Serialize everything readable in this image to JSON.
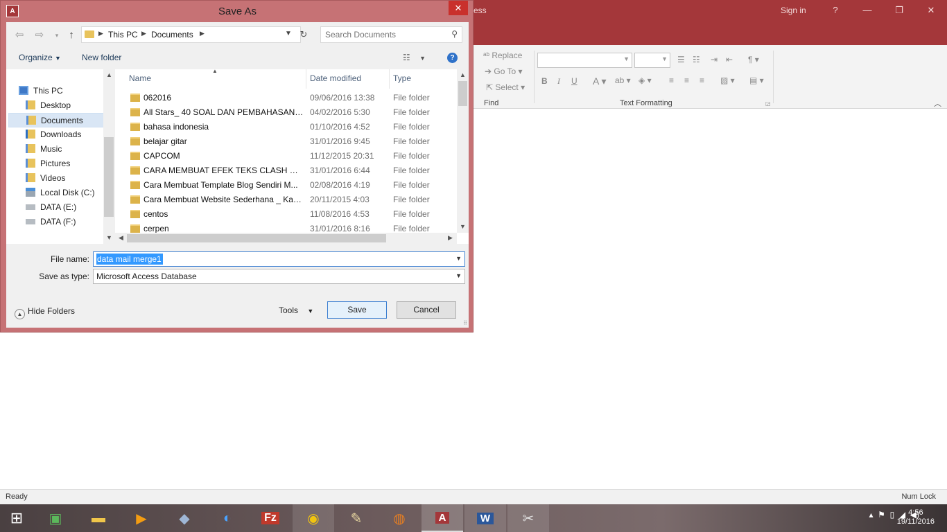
{
  "access": {
    "title_fragment": "ess",
    "sign_in": "Sign in",
    "help": "?",
    "ribbon": {
      "replace": "Replace",
      "go_to": "Go To",
      "select": "Select",
      "find_group": "Find",
      "text_formatting_group": "Text Formatting",
      "bold": "B",
      "italic": "I",
      "underline": "U"
    },
    "status": {
      "left": "Ready",
      "right": "Num Lock"
    }
  },
  "dialog": {
    "title": "Save As",
    "app_icon_text": "A",
    "close": "✕",
    "breadcrumbs": [
      "This PC",
      "Documents"
    ],
    "search_placeholder": "Search Documents",
    "organize": "Organize",
    "new_folder": "New folder",
    "help": "?",
    "nav": [
      {
        "label": "This PC",
        "icon": "computer-icon",
        "indent": 0
      },
      {
        "label": "Desktop",
        "icon": "desktop-icon",
        "indent": 1
      },
      {
        "label": "Documents",
        "icon": "documents-icon",
        "indent": 1,
        "selected": true
      },
      {
        "label": "Downloads",
        "icon": "downloads-icon",
        "indent": 1
      },
      {
        "label": "Music",
        "icon": "music-icon",
        "indent": 1
      },
      {
        "label": "Pictures",
        "icon": "pictures-icon",
        "indent": 1
      },
      {
        "label": "Videos",
        "icon": "videos-icon",
        "indent": 1
      },
      {
        "label": "Local Disk (C:)",
        "icon": "disk-icon",
        "indent": 1
      },
      {
        "label": "DATA (E:)",
        "icon": "drive-icon",
        "indent": 1
      },
      {
        "label": "DATA (F:)",
        "icon": "drive-icon",
        "indent": 1
      }
    ],
    "columns": {
      "name": "Name",
      "date": "Date modified",
      "type": "Type"
    },
    "files": [
      {
        "name": "062016",
        "date": "09/06/2016 13:38",
        "type": "File folder"
      },
      {
        "name": "All Stars_ 40 SOAL DAN PEMBAHASAN D...",
        "date": "04/02/2016 5:30",
        "type": "File folder"
      },
      {
        "name": "bahasa indonesia",
        "date": "01/10/2016 4:52",
        "type": "File folder"
      },
      {
        "name": "belajar gitar",
        "date": "31/01/2016 9:45",
        "type": "File folder"
      },
      {
        "name": "CAPCOM",
        "date": "11/12/2015 20:31",
        "type": "File folder"
      },
      {
        "name": "CARA MEMBUAT EFEK TEKS CLASH OF ...",
        "date": "31/01/2016 6:44",
        "type": "File folder"
      },
      {
        "name": "Cara Membuat Template Blog Sendiri M...",
        "date": "02/08/2016 4:19",
        "type": "File folder"
      },
      {
        "name": "Cara Membuat Website Sederhana _ Kam...",
        "date": "20/11/2015 4:03",
        "type": "File folder"
      },
      {
        "name": "centos",
        "date": "11/08/2016 4:53",
        "type": "File folder"
      },
      {
        "name": "cerpen",
        "date": "31/01/2016 8:16",
        "type": "File folder"
      }
    ],
    "file_name_label": "File name:",
    "file_name_value": "data mail merge1",
    "save_type_label": "Save as type:",
    "save_type_value": "Microsoft Access Database",
    "hide_folders": "Hide Folders",
    "tools": "Tools",
    "save": "Save",
    "cancel": "Cancel"
  },
  "taskbar": {
    "clock_time": "4:56",
    "clock_date": "19/11/2016",
    "apps": [
      "start-icon",
      "store-icon",
      "file-explorer-icon",
      "media-player-icon",
      "virtualbox-icon",
      "network-icon",
      "filezilla-icon",
      "chrome-icon",
      "paint-icon",
      "firefox-icon",
      "access-icon",
      "word-icon",
      "snipping-icon"
    ]
  },
  "colors": {
    "accent": "#a4373a",
    "dialog_frame": "#c67275",
    "selection": "#3399ff"
  }
}
